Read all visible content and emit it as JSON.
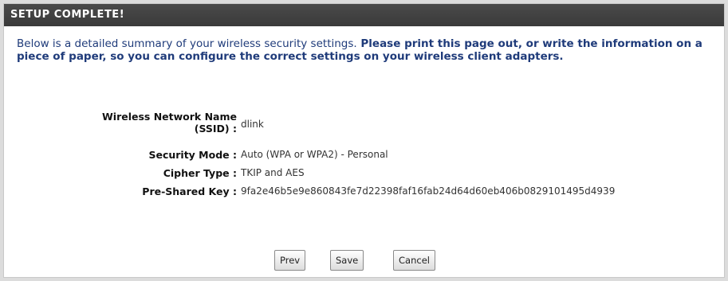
{
  "header": {
    "title": "SETUP COMPLETE!"
  },
  "intro": {
    "normal": "Below is a detailed summary of your wireless security settings.",
    "bold": "Please print this page out, or write the information on a piece of paper, so you can configure the correct settings on your wireless client adapters."
  },
  "summary": {
    "ssid_label_line1": "Wireless Network Name",
    "ssid_label_line2": "(SSID) :",
    "ssid_value": "dlink",
    "security_label": "Security Mode :",
    "security_value": "Auto (WPA or WPA2) - Personal",
    "cipher_label": "Cipher Type :",
    "cipher_value": "TKIP and AES",
    "psk_label": "Pre-Shared Key :",
    "psk_value": "9fa2e46b5e9e860843fe7d22398faf16fab24d64d60eb406b0829101495d4939"
  },
  "buttons": {
    "prev": "Prev",
    "save": "Save",
    "cancel": "Cancel"
  }
}
